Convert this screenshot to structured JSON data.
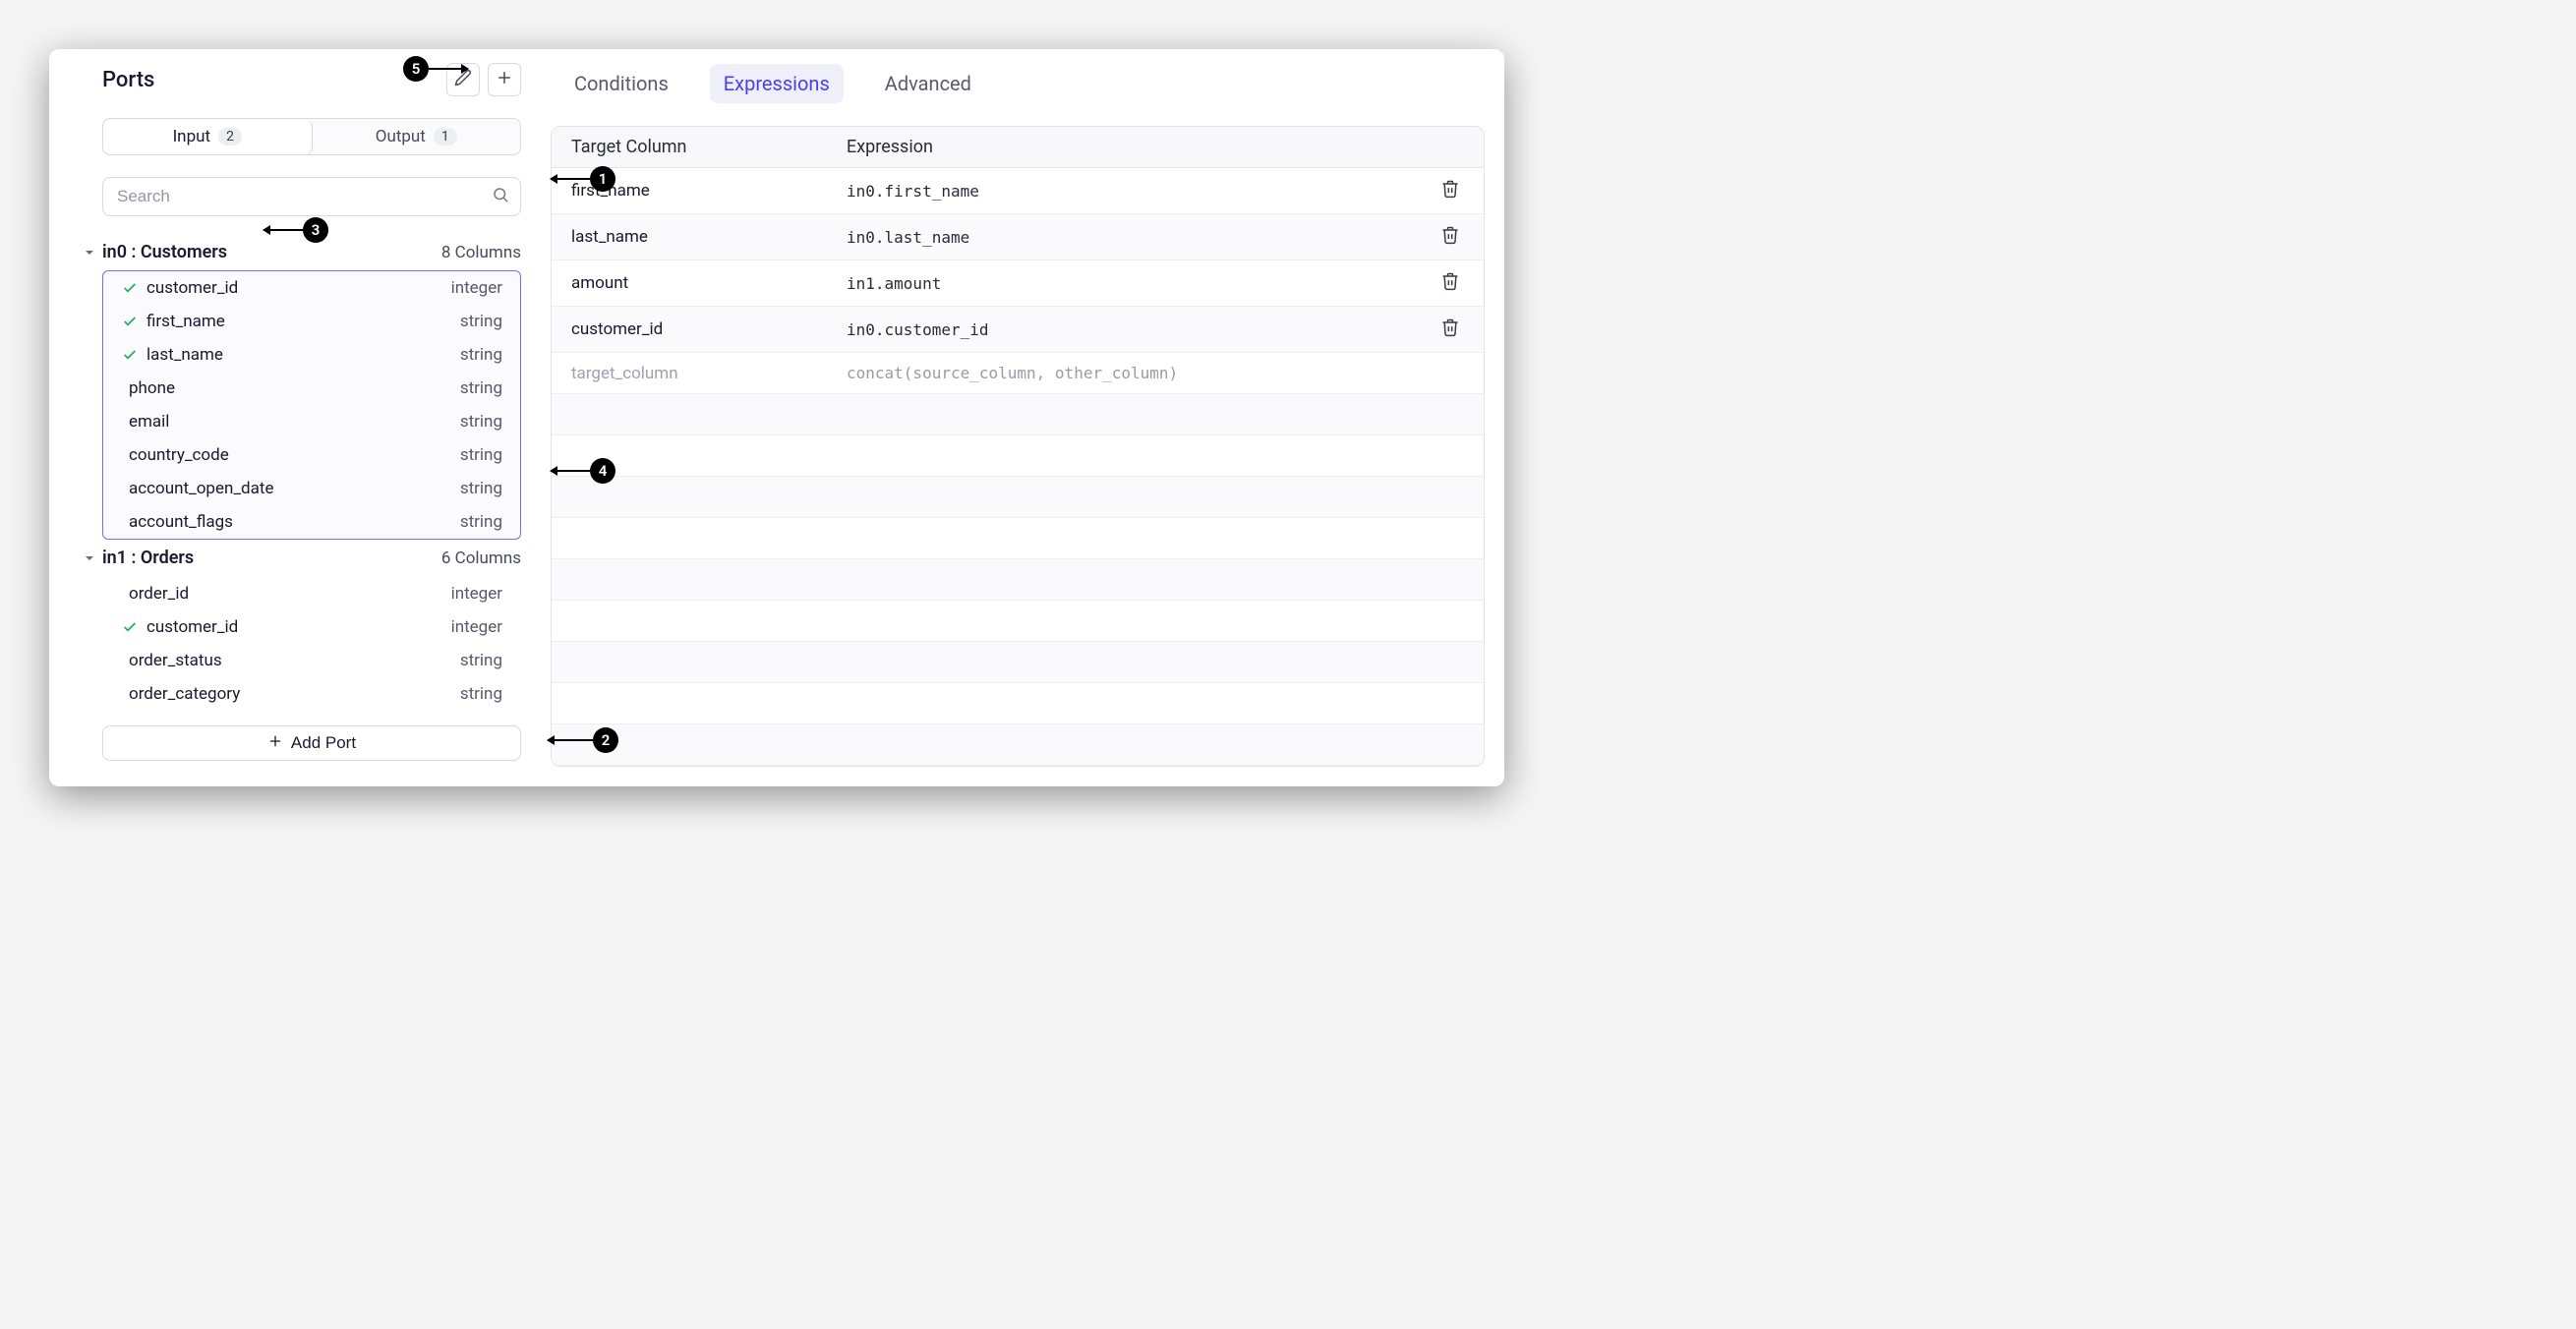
{
  "left_panel": {
    "title": "Ports",
    "io_tabs": {
      "input": {
        "label": "Input",
        "count": "2",
        "active": true
      },
      "output": {
        "label": "Output",
        "count": "1",
        "active": false
      }
    },
    "search_placeholder": "Search",
    "ports": [
      {
        "id": "in0",
        "label": "in0 : Customers",
        "column_count": "8 Columns",
        "highlighted": true,
        "columns": [
          {
            "name": "customer_id",
            "type": "integer",
            "checked": true
          },
          {
            "name": "first_name",
            "type": "string",
            "checked": true
          },
          {
            "name": "last_name",
            "type": "string",
            "checked": true
          },
          {
            "name": "phone",
            "type": "string",
            "checked": false
          },
          {
            "name": "email",
            "type": "string",
            "checked": false
          },
          {
            "name": "country_code",
            "type": "string",
            "checked": false
          },
          {
            "name": "account_open_date",
            "type": "string",
            "checked": false
          },
          {
            "name": "account_flags",
            "type": "string",
            "checked": false
          }
        ]
      },
      {
        "id": "in1",
        "label": "in1 : Orders",
        "column_count": "6 Columns",
        "highlighted": false,
        "columns": [
          {
            "name": "order_id",
            "type": "integer",
            "checked": false
          },
          {
            "name": "customer_id",
            "type": "integer",
            "checked": true
          },
          {
            "name": "order_status",
            "type": "string",
            "checked": false
          },
          {
            "name": "order_category",
            "type": "string",
            "checked": false
          }
        ]
      }
    ],
    "add_port_label": "Add Port"
  },
  "right_panel": {
    "tabs": [
      {
        "label": "Conditions",
        "active": false
      },
      {
        "label": "Expressions",
        "active": true
      },
      {
        "label": "Advanced",
        "active": false
      }
    ],
    "table": {
      "headers": {
        "target": "Target Column",
        "expression": "Expression"
      },
      "rows": [
        {
          "target": "first_name",
          "expression": "in0.first_name"
        },
        {
          "target": "last_name",
          "expression": "in0.last_name"
        },
        {
          "target": "amount",
          "expression": "in1.amount"
        },
        {
          "target": "customer_id",
          "expression": "in0.customer_id"
        }
      ],
      "placeholder": {
        "target": "target_column",
        "expression": "concat(source_column, other_column)"
      }
    }
  },
  "callouts": {
    "1": "1",
    "2": "2",
    "3": "3",
    "4": "4",
    "5": "5"
  }
}
